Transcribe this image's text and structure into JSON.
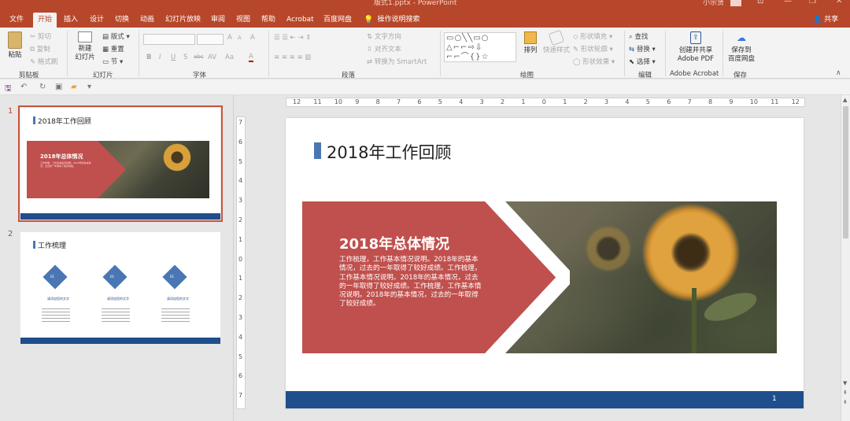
{
  "window": {
    "title": "版式1.pptx - PowerPoint",
    "user": "小宗贤"
  },
  "tabs": [
    {
      "label": "文件"
    },
    {
      "label": "开始"
    },
    {
      "label": "插入"
    },
    {
      "label": "设计"
    },
    {
      "label": "切换"
    },
    {
      "label": "动画"
    },
    {
      "label": "幻灯片放映"
    },
    {
      "label": "审阅"
    },
    {
      "label": "视图"
    },
    {
      "label": "帮助"
    },
    {
      "label": "Acrobat"
    },
    {
      "label": "百度网盘"
    }
  ],
  "tell_me": "操作说明搜索",
  "share": "共享",
  "ribbon": {
    "clipboard": {
      "paste": "粘贴",
      "cut": "剪切",
      "copy": "复制",
      "format_painter": "格式刷",
      "label": "剪贴板"
    },
    "slides": {
      "new_slide_l1": "新建",
      "new_slide_l2": "幻灯片",
      "layout": "版式",
      "reset": "重置",
      "section": "节",
      "label": "幻灯片"
    },
    "font": {
      "label": "字体",
      "bold": "B",
      "italic": "I",
      "underline": "U",
      "shadow": "S",
      "strike": "abc",
      "spacing": "AV",
      "case": "Aa",
      "color": "A",
      "grow": "A",
      "shrink": "A",
      "clear": "A"
    },
    "paragraph": {
      "text_direction": "文字方向",
      "align_text": "对齐文本",
      "smartart": "转换为 SmartArt",
      "label": "段落"
    },
    "drawing": {
      "arrange": "排列",
      "quick_styles": "快速样式",
      "shape_fill": "形状填充",
      "shape_outline": "形状轮廓",
      "shape_effects": "形状效果",
      "label": "绘图"
    },
    "editing": {
      "find": "查找",
      "replace": "替换",
      "select": "选择",
      "label": "编辑"
    },
    "adobe": {
      "l1": "创建并共享",
      "l2": "Adobe PDF",
      "label": "Adobe Acrobat"
    },
    "save": {
      "l1": "保存到",
      "l2": "百度网盘",
      "label": "保存"
    }
  },
  "thumbnails": [
    {
      "num": "1",
      "title": "2018年工作回顾",
      "heading": "2018年总体情况",
      "body": "工作梳理，工作基本情况说明。2018年的基本情况，过去的一年取得了较好成绩。"
    },
    {
      "num": "2",
      "title": "工作梳理",
      "items": [
        {
          "badge": "01",
          "label": "请添加您的文字"
        },
        {
          "badge": "01",
          "label": "请添加您的文字"
        },
        {
          "badge": "01",
          "label": "请添加您的文字"
        }
      ]
    }
  ],
  "ruler": {
    "h_ticks": [
      "12",
      "11",
      "10",
      "9",
      "8",
      "7",
      "6",
      "5",
      "4",
      "3",
      "2",
      "1",
      "0",
      "1",
      "2",
      "3",
      "4",
      "5",
      "6",
      "7",
      "8",
      "9",
      "10",
      "11",
      "12"
    ],
    "v_ticks": [
      "7",
      "6",
      "5",
      "4",
      "3",
      "2",
      "1",
      "0",
      "1",
      "2",
      "3",
      "4",
      "5",
      "6",
      "7"
    ]
  },
  "slide": {
    "title": "2018年工作回顾",
    "box_heading": "2018年总体情况",
    "box_body": "工作梳理，工作基本情况说明。2018年的基本情况，过去的一年取得了较好成绩。工作梳理，工作基本情况说明。2018年的基本情况，过去的一年取得了较好成绩。工作梳理，工作基本情况说明。2018年的基本情况，过去的一年取得了较好成绩。",
    "page_number": "1",
    "accent_color": "#c0504d",
    "bar_color": "#1f4e8c",
    "title_marker_color": "#4a77b4"
  },
  "colors": {
    "ribbon_red": "#b7472a"
  }
}
